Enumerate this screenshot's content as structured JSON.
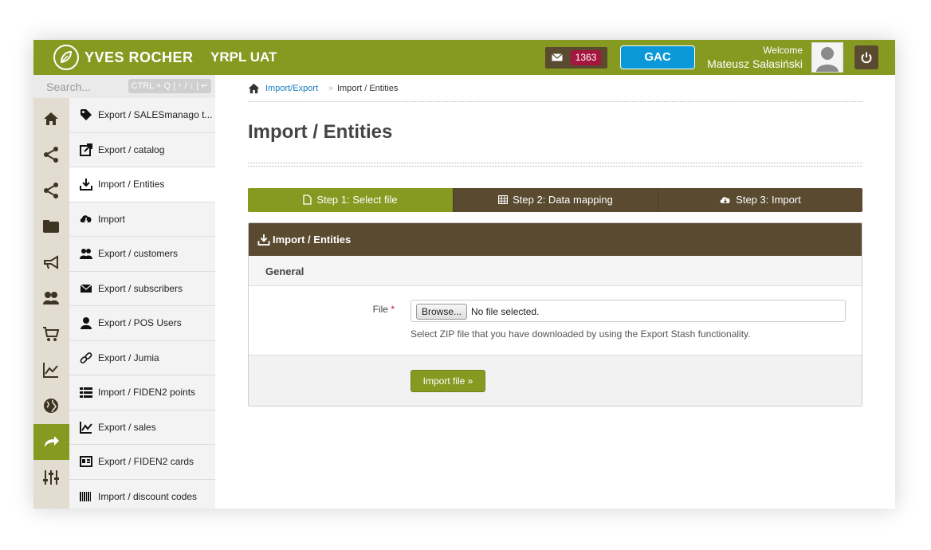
{
  "header": {
    "brand": "YVES ROCHER",
    "environment": "YRPL UAT",
    "messages_count": "1363",
    "org_button": "GAC",
    "welcome": "Welcome",
    "user_name": "Mateusz Sałasiński"
  },
  "search": {
    "placeholder": "Search...",
    "shortcut_hint": "CTRL + Q | ↑ / ↓ | ↵"
  },
  "rail": [
    {
      "icon": "home-icon"
    },
    {
      "icon": "share-icon"
    },
    {
      "icon": "share-icon"
    },
    {
      "icon": "folder-icon"
    },
    {
      "icon": "megaphone-icon"
    },
    {
      "icon": "users-icon"
    },
    {
      "icon": "cart-icon"
    },
    {
      "icon": "chart-icon"
    },
    {
      "icon": "globe-icon"
    },
    {
      "icon": "export-arrow-icon",
      "active": true
    },
    {
      "icon": "sliders-icon"
    }
  ],
  "menu": {
    "items": [
      {
        "label": "Export / SALESmanago t...",
        "icon": "tag-icon"
      },
      {
        "label": "Export / catalog",
        "icon": "external-link-icon"
      },
      {
        "label": "Import / Entities",
        "icon": "download-icon",
        "active": true
      },
      {
        "label": "Import",
        "icon": "cloud-download-icon"
      },
      {
        "label": "Export / customers",
        "icon": "users-icon"
      },
      {
        "label": "Export / subscribers",
        "icon": "envelope-icon"
      },
      {
        "label": "Export / POS Users",
        "icon": "user-icon"
      },
      {
        "label": "Export / Jumia",
        "icon": "link-icon"
      },
      {
        "label": "Import / FIDEN2 points",
        "icon": "list-icon"
      },
      {
        "label": "Export / sales",
        "icon": "chart-icon"
      },
      {
        "label": "Export / FIDEN2 cards",
        "icon": "card-icon"
      },
      {
        "label": "Import / discount codes",
        "icon": "barcode-icon"
      }
    ]
  },
  "breadcrumb": {
    "parent": "Import/Export",
    "separator": "»",
    "current": "Import / Entities"
  },
  "page": {
    "title": "Import / Entities"
  },
  "steps": [
    {
      "label": "Step 1: Select file",
      "icon": "file-icon",
      "active": true
    },
    {
      "label": "Step 2: Data mapping",
      "icon": "table-icon"
    },
    {
      "label": "Step 3: Import",
      "icon": "cloud-download-icon"
    }
  ],
  "panel": {
    "title": "Import / Entities",
    "section": "General",
    "file_label": "File",
    "required_mark": "*",
    "browse_label": "Browse...",
    "file_status": "No file selected.",
    "help": "Select ZIP file that you have downloaded by using the Export Stash functionality.",
    "submit_label": "Import file »"
  },
  "colors": {
    "olive": "#869a22",
    "brown": "#5a4a30",
    "badge": "#a5163e",
    "blue": "#0a98d8",
    "link": "#1a7fbd"
  }
}
